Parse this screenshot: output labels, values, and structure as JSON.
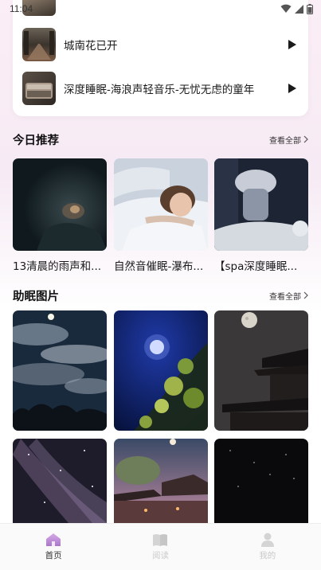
{
  "status_bar": {
    "time": "11:04"
  },
  "playlist": {
    "tracks": [
      {
        "title": "城南花已开"
      },
      {
        "title": "深度睡眠-海浪声轻音乐-无忧无虑的童年"
      }
    ]
  },
  "today": {
    "title": "今日推荐",
    "view_all": "查看全部",
    "items": [
      {
        "title": "13清晨的雨声和..."
      },
      {
        "title": "自然音催眠-瀑布..."
      },
      {
        "title": "【spa深度睡眠..."
      }
    ]
  },
  "sleep_images": {
    "title": "助眠图片",
    "view_all": "查看全部"
  },
  "tabs": [
    {
      "label": "首页",
      "active": true
    },
    {
      "label": "阅读",
      "active": false
    },
    {
      "label": "我的",
      "active": false
    }
  ],
  "colors": {
    "accent": "#c18fd8",
    "inactive": "#d4d4d4"
  }
}
